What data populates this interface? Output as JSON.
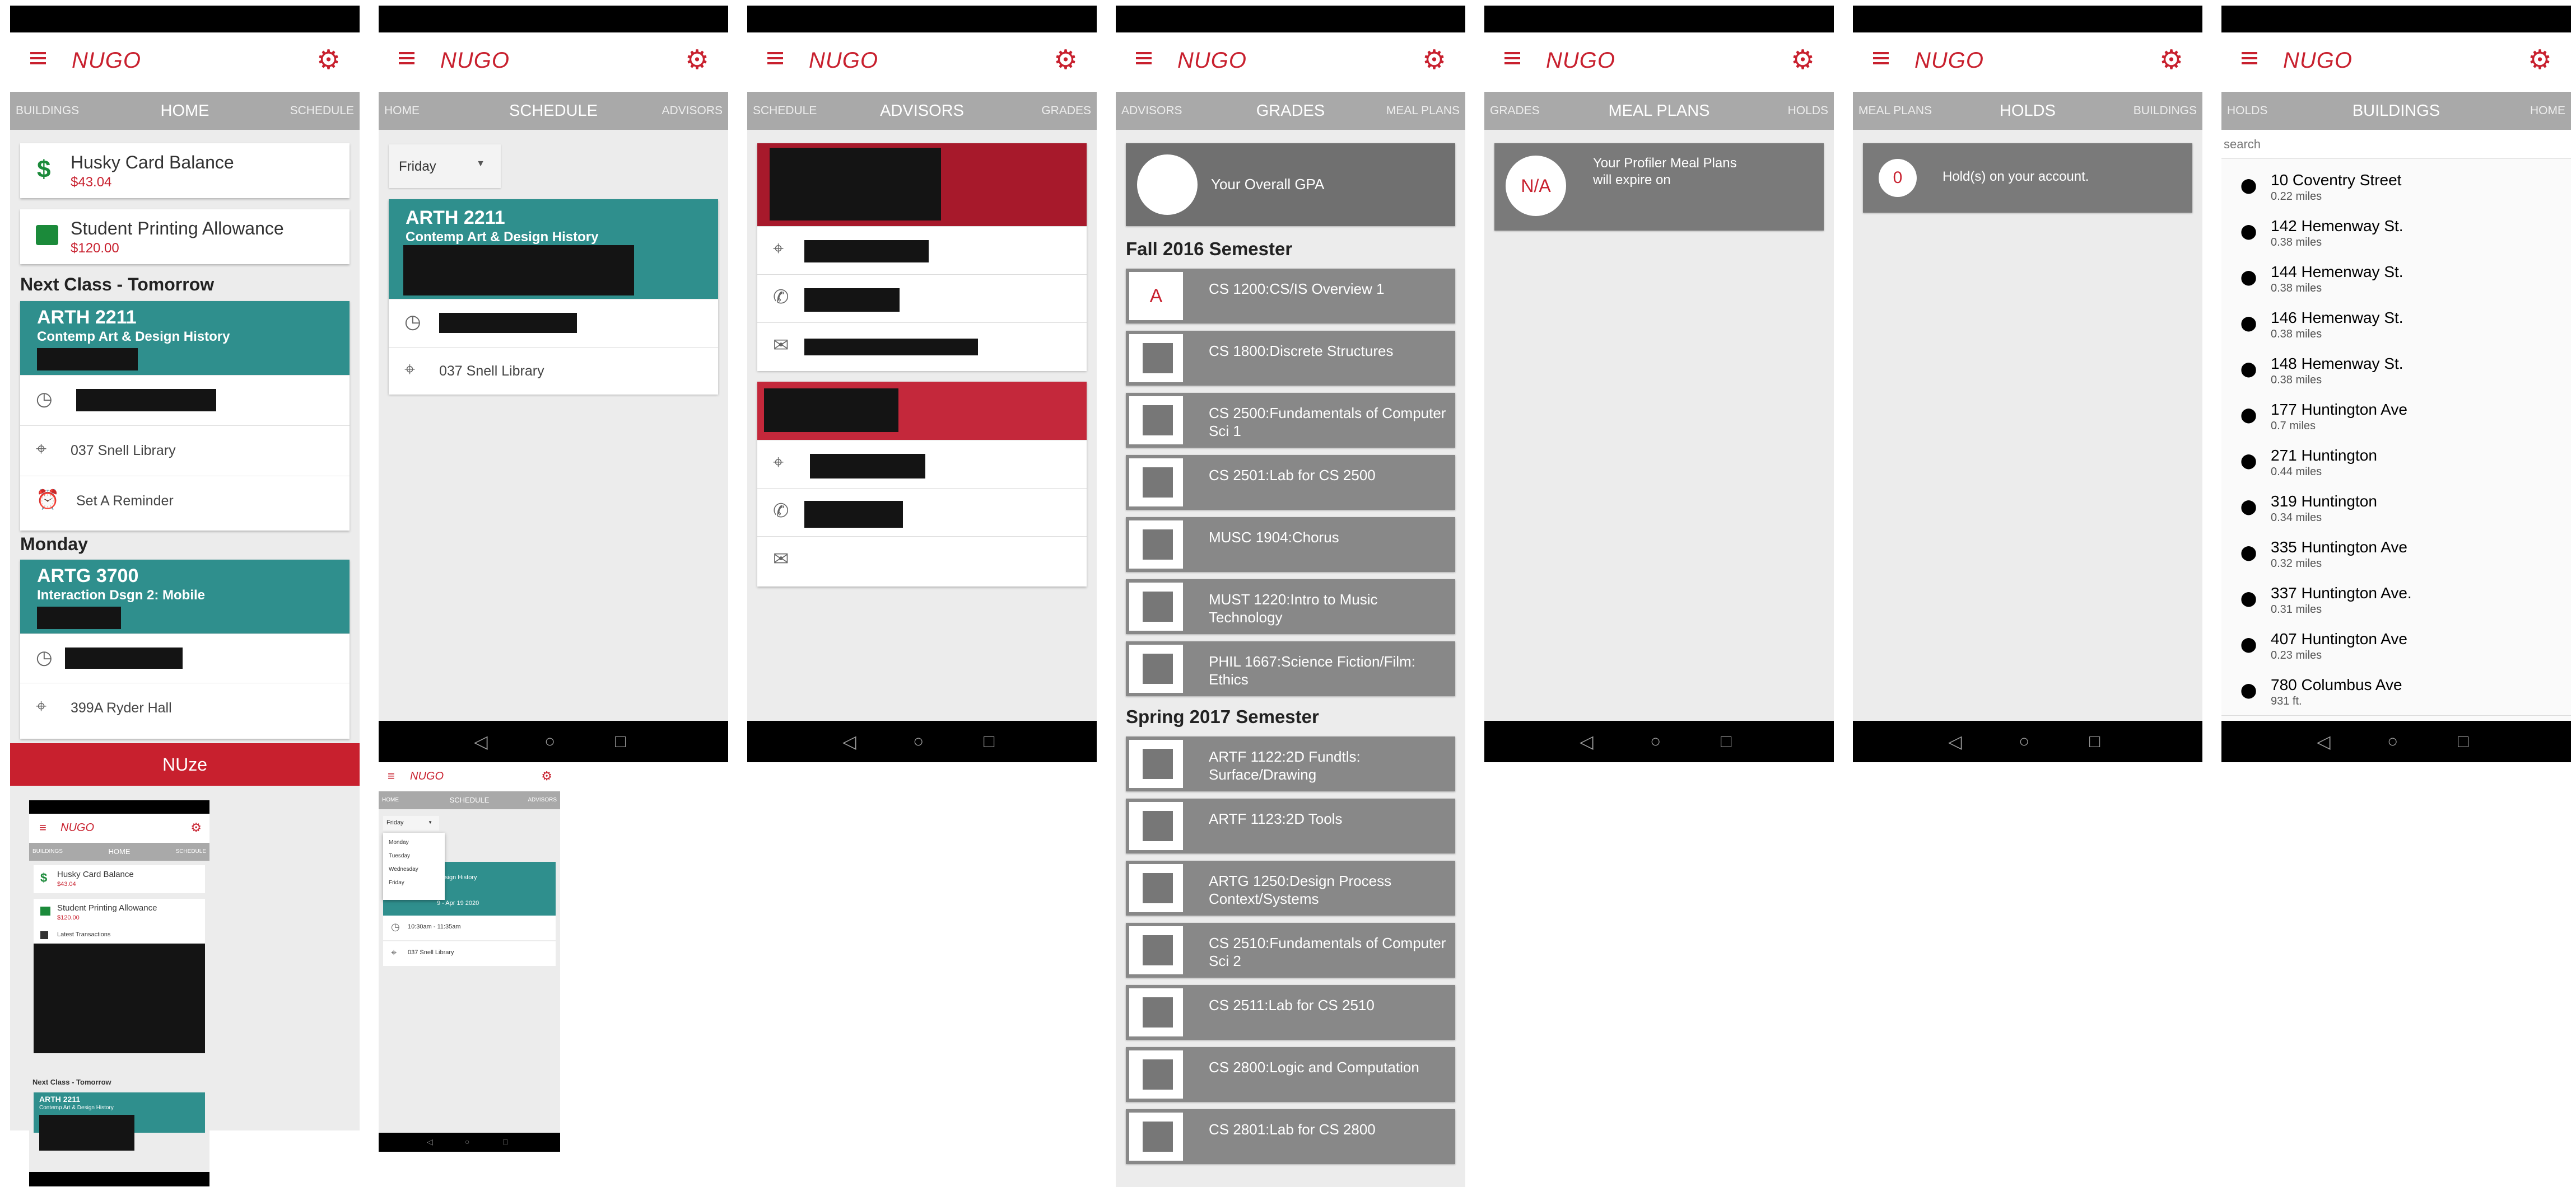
{
  "app": {
    "brand": "NUGO",
    "bottom_banner": "NUze"
  },
  "colors": {
    "brand_red": "#c8202e",
    "teal": "#2f8f8d",
    "tab_gray": "#a9a9a9",
    "grade_gray": "#888888"
  },
  "screens": {
    "home": {
      "tabs": {
        "prev": "BUILDINGS",
        "current": "HOME",
        "next": "SCHEDULE"
      },
      "husky_label": "Husky Card Balance",
      "husky_value": "$43.04",
      "print_label": "Student Printing Allowance",
      "print_value": "$120.00",
      "next_class_heading": "Next Class - Tomorrow",
      "class1_code": "ARTH 2211",
      "class1_name": "Contemp Art & Design History",
      "class1_location": "037 Snell Library",
      "reminder_label": "Set A Reminder",
      "monday_heading": "Monday",
      "class2_code": "ARTG 3700",
      "class2_name": "Interaction Dsgn 2: Mobile",
      "class2_location": "399A Ryder Hall"
    },
    "schedule": {
      "tabs": {
        "prev": "HOME",
        "current": "SCHEDULE",
        "next": "ADVISORS"
      },
      "day_selected": "Friday",
      "class_code": "ARTH 2211",
      "class_name": "Contemp Art & Design History",
      "location": "037 Snell Library"
    },
    "advisors": {
      "tabs": {
        "prev": "SCHEDULE",
        "current": "ADVISORS",
        "next": "GRADES"
      }
    },
    "grades": {
      "tabs": {
        "prev": "ADVISORS",
        "current": "GRADES",
        "next": "MEAL PLANS"
      },
      "gpa_label": "Your Overall GPA",
      "fall_heading": "Fall 2016 Semester",
      "fall_courses": [
        {
          "grade": "A",
          "name": "CS 1200:CS/IS Overview 1"
        },
        {
          "grade": "",
          "name": "CS 1800:Discrete Structures"
        },
        {
          "grade": "",
          "name": "CS 2500:Fundamentals of Computer Sci 1"
        },
        {
          "grade": "",
          "name": "CS 2501:Lab for CS 2500"
        },
        {
          "grade": "",
          "name": "MUSC 1904:Chorus"
        },
        {
          "grade": "",
          "name": "MUST 1220:Intro to Music Technology"
        },
        {
          "grade": "",
          "name": "PHIL 1667:Science Fiction/Film: Ethics"
        }
      ],
      "spring_heading": "Spring 2017 Semester",
      "spring_courses": [
        {
          "name": "ARTF 1122:2D Fundtls: Surface/Drawing"
        },
        {
          "name": "ARTF 1123:2D Tools"
        },
        {
          "name": "ARTG 1250:Design Process Context/Systems"
        },
        {
          "name": "CS 2510:Fundamentals of Computer Sci 2"
        },
        {
          "name": "CS 2511:Lab for CS 2510"
        },
        {
          "name": "CS 2800:Logic and Computation"
        },
        {
          "name": "CS 2801:Lab for CS 2800"
        }
      ]
    },
    "meal_plans": {
      "tabs": {
        "prev": "GRADES",
        "current": "MEAL PLANS",
        "next": "HOLDS"
      },
      "badge": "N/A",
      "text_line1": "Your Profiler Meal Plans",
      "text_line2": "will expire on"
    },
    "holds": {
      "tabs": {
        "prev": "MEAL PLANS",
        "current": "HOLDS",
        "next": "BUILDINGS"
      },
      "count": "0",
      "text": "Hold(s) on your account."
    },
    "buildings": {
      "tabs": {
        "prev": "HOLDS",
        "current": "BUILDINGS",
        "next": "HOME"
      },
      "search_placeholder": "search",
      "items": [
        {
          "name": "10 Coventry Street",
          "distance": "0.22 miles"
        },
        {
          "name": "142 Hemenway St.",
          "distance": "0.38 miles"
        },
        {
          "name": "144 Hemenway St.",
          "distance": "0.38 miles"
        },
        {
          "name": "146 Hemenway St.",
          "distance": "0.38 miles"
        },
        {
          "name": "148 Hemenway St.",
          "distance": "0.38 miles"
        },
        {
          "name": "177 Huntington Ave",
          "distance": "0.7 miles"
        },
        {
          "name": "271 Huntington",
          "distance": "0.44 miles"
        },
        {
          "name": "319 Huntington",
          "distance": "0.34 miles"
        },
        {
          "name": "335 Huntington Ave",
          "distance": "0.32 miles"
        },
        {
          "name": "337 Huntington Ave.",
          "distance": "0.31 miles"
        },
        {
          "name": "407 Huntington Ave",
          "distance": "0.23 miles"
        },
        {
          "name": "780 Columbus Ave",
          "distance": "931 ft."
        }
      ]
    },
    "mini_home": {
      "tabs": {
        "prev": "BUILDINGS",
        "current": "HOME",
        "next": "SCHEDULE"
      },
      "husky_label": "Husky Card Balance",
      "husky_value": "$43.04",
      "print_label": "Student Printing Allowance",
      "print_value": "$120.00",
      "latest_label": "Latest Transactions",
      "next_class_heading": "Next Class - Tomorrow",
      "class_code": "ARTH 2211",
      "class_name": "Contemp Art & Design History"
    },
    "mini_schedule": {
      "tabs": {
        "prev": "HOME",
        "current": "SCHEDULE",
        "next": "ADVISORS"
      },
      "day_selected": "Friday",
      "dropdown_days": [
        "Monday",
        "Tuesday",
        "Wednesday",
        "Friday"
      ],
      "class_name": "Design History",
      "class_dates": "9 - Apr 19 2020",
      "time": "10:30am - 11:35am",
      "location": "037 Snell Library"
    }
  }
}
